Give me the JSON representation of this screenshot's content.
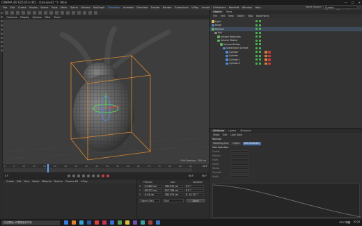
{
  "window": {
    "title": "CINEMA 4D R25.010 (RC) - [Unsaved1 *] - Main",
    "controls": [
      "—",
      "□",
      "✕"
    ]
  },
  "menubar": {
    "items": [
      "File",
      "Edit",
      "Create",
      "Modes",
      "Select",
      "Tools",
      "Mesh",
      "Spline",
      "Volume",
      "MoGraph",
      "Character",
      "Animate",
      "Simulate",
      "Tracker",
      "Render",
      "Extensions",
      "V-Ray",
      "Arnold",
      "X-Particles",
      "Redshift",
      "Window",
      "Help"
    ],
    "active_index": 10,
    "layout_label": "Node Space:",
    "layout_value": "Current (Standard/Physical)"
  },
  "viewport": {
    "menu": [
      "Cameras",
      "Display",
      "Options",
      "Filter",
      "Panel"
    ],
    "grid_spacing": "Grid Spacing : 100 cm"
  },
  "timeline": {
    "ticks": [
      "0",
      "5",
      "10",
      "15",
      "20",
      "25",
      "30",
      "35",
      "40",
      "45",
      "50",
      "55",
      "60",
      "65",
      "70",
      "75",
      "80",
      "85",
      "90"
    ],
    "current_frame": "20 F"
  },
  "playbar": {
    "start": "0 F",
    "end1": "90 F",
    "end2": "90 F"
  },
  "material_panel": {
    "menu": [
      "Create",
      "Edit",
      "View",
      "Select",
      "Material",
      "Texture",
      "Cinema 4D",
      "V-Ray"
    ]
  },
  "coords": {
    "headers": [
      "Position",
      "Size",
      "Rotation"
    ],
    "rows": [
      {
        "axis": "X",
        "pos": "-31.896 cm",
        "size": "382.819 cm",
        "rot": "H  0 °"
      },
      {
        "axis": "Y",
        "pos": "-58.272 cm",
        "size": "617.786 cm",
        "rot": "P  0 °"
      },
      {
        "axis": "Z",
        "pos": "-9.54 cm",
        "size": "385.974 cm",
        "rot": "B  -19.127 °"
      }
    ],
    "mode_select": "Object (Rel)",
    "size_select": "Size",
    "apply_label": "Apply"
  },
  "objects_panel": {
    "tabs": [
      "Objects",
      "Takes"
    ],
    "menu": [
      "File",
      "Edit",
      "View",
      "Object",
      "Tags",
      "Bookmarks"
    ],
    "tree": [
      {
        "name": "Light",
        "depth": 0,
        "color": "#e0c060"
      },
      {
        "name": "Bulge",
        "depth": 0,
        "color": "#4c8cd8"
      },
      {
        "name": "Remesh",
        "depth": 0,
        "color": "#60b060"
      },
      {
        "name": "Null",
        "depth": 1,
        "color": "#888888"
      },
      {
        "name": "Volume Reduction",
        "depth": 2,
        "color": "#60b060"
      },
      {
        "name": "Volume Mesher",
        "depth": 2,
        "color": "#60b060"
      },
      {
        "name": "Volume Builder",
        "depth": 3,
        "color": "#60b060"
      },
      {
        "name": "Subdivision Surface",
        "depth": 4,
        "color": "#4c8cd8"
      },
      {
        "name": "Cylinder",
        "depth": 5,
        "color": "#4c8cd8"
      },
      {
        "name": "Cylinder",
        "depth": 5,
        "color": "#4c8cd8"
      },
      {
        "name": "Cylinder.1",
        "depth": 5,
        "color": "#4c8cd8"
      },
      {
        "name": "Cylinder.2",
        "depth": 5,
        "color": "#4c8cd8"
      }
    ]
  },
  "attributes_panel": {
    "tabs": [
      "Attributes",
      "Layers",
      "Structure"
    ],
    "menu": [
      "Mode",
      "Edit",
      "User Data"
    ],
    "object_name": "Remesh",
    "subtabs": [
      "Modeling Axis",
      "Object",
      "Soft Selection"
    ],
    "active_subtab": 2,
    "section_title": "Soft Selection",
    "properties": [
      "Enable",
      "Restrict",
      "Mode",
      "Falloff",
      "Radius",
      "Strength",
      "Width"
    ]
  },
  "taskbar": {
    "search_placeholder": "在这里输入你要搜索的内容",
    "apps": [
      "#3c7bd8",
      "#e08030",
      "#3aa0d8",
      "#2a5aa8",
      "#d84040",
      "#c03060",
      "#3a6ad8",
      "#5aa050",
      "#e0c040",
      "#7050b0",
      "#40a0a0",
      "#a04040",
      "#4070c0"
    ],
    "weather": "15°C 晴朗",
    "time": "10:24"
  }
}
